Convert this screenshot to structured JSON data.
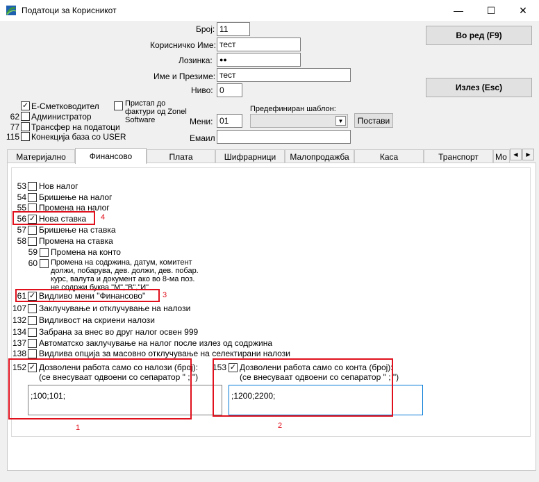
{
  "window": {
    "title": "Податоци за Корисникот",
    "controls": {
      "minimize": "—",
      "maximize": "☐",
      "close": "✕"
    }
  },
  "form": {
    "broj_label": "Број:",
    "broj_value": "11",
    "username_label": "Корисничко Име:",
    "username_value": "тест",
    "password_label": "Лозинка:",
    "password_value": "●●",
    "fullname_label": "Име и Презиме:",
    "fullname_value": "тест",
    "nivo_label": "Ниво:",
    "nivo_value": "0",
    "meni_label": "Мени:",
    "meni_value": "01",
    "email_label": "Емаил",
    "email_value": "",
    "template_label": "Предефиниран шаблон:",
    "template_value": "",
    "set_button": "Постави"
  },
  "buttons": {
    "ok": "Во ред (F9)",
    "exit": "Излез (Esc)"
  },
  "roles": [
    {
      "num": "",
      "label": "Е-Сметководител",
      "checked": true
    },
    {
      "num": "62",
      "label": "Администратор",
      "checked": false
    },
    {
      "num": "77",
      "label": "Трансфер на податоци",
      "checked": false
    },
    {
      "num": "115",
      "label": "Конекција база со USER",
      "checked": false
    }
  ],
  "zonel": {
    "label": "Пристап до фактури од Zonel Software",
    "checked": false
  },
  "tabs": [
    "Материјално",
    "Финансово",
    "Плата",
    "Шифрарници",
    "Малопродажба",
    "Каса",
    "Транспорт",
    "Мо"
  ],
  "active_tab": "Финансово",
  "permissions": [
    {
      "num": "53",
      "label": "Нов налог",
      "checked": false
    },
    {
      "num": "54",
      "label": "Бришење на налог",
      "checked": false
    },
    {
      "num": "55",
      "label": "Промена на налог",
      "checked": false
    },
    {
      "num": "56",
      "label": "Нова ставка",
      "checked": true
    },
    {
      "num": "57",
      "label": "Бришење на ставка",
      "checked": false
    },
    {
      "num": "58",
      "label": "Промена на ставка",
      "checked": false
    },
    {
      "num": "59",
      "label": "Промена на конто",
      "checked": false
    },
    {
      "num": "60",
      "label": "Промена на содржина, датум, комитент должи, побарува, дев. должи, дев. побар. курс, валута и документ ако во 8-ма поз. не содржи буква  \"M\",\"B\",\"И\"",
      "checked": false
    },
    {
      "num": "61",
      "label": "Видливо мени \"Финансово\"",
      "checked": true
    },
    {
      "num": "107",
      "label": "Заклучување и отклучување на налози",
      "checked": false
    },
    {
      "num": "132",
      "label": "Видливост на скриени налози",
      "checked": false
    },
    {
      "num": "134",
      "label": "Забрана за внес во друг налог освен 999",
      "checked": false
    },
    {
      "num": "137",
      "label": "Автоматско заклучување на налог после излез од содржина",
      "checked": false
    },
    {
      "num": "138",
      "label": "Видлива опција за масовно отклучување на селектирани налози",
      "checked": false
    }
  ],
  "restrict_orders": {
    "num": "152",
    "checked": true,
    "line1": "Дозволени работа само со налози (број):",
    "line2": "(се внесуваат одвоени со сепаратор \" ; \")",
    "value": ";100;101;"
  },
  "restrict_accounts": {
    "num": "153",
    "checked": true,
    "line1": "Дозволени работа само со конта (број):",
    "line2": "(се внесуваат одвоени со сепаратор \" ; \")",
    "value": ";1200;2200;"
  },
  "annotations": [
    "1",
    "2",
    "3",
    "4"
  ],
  "colors": {
    "annotation": "#e0101c",
    "accent": "#0078d7",
    "icon_green": "#3a9a3a",
    "icon_blue": "#1f5fb0"
  }
}
